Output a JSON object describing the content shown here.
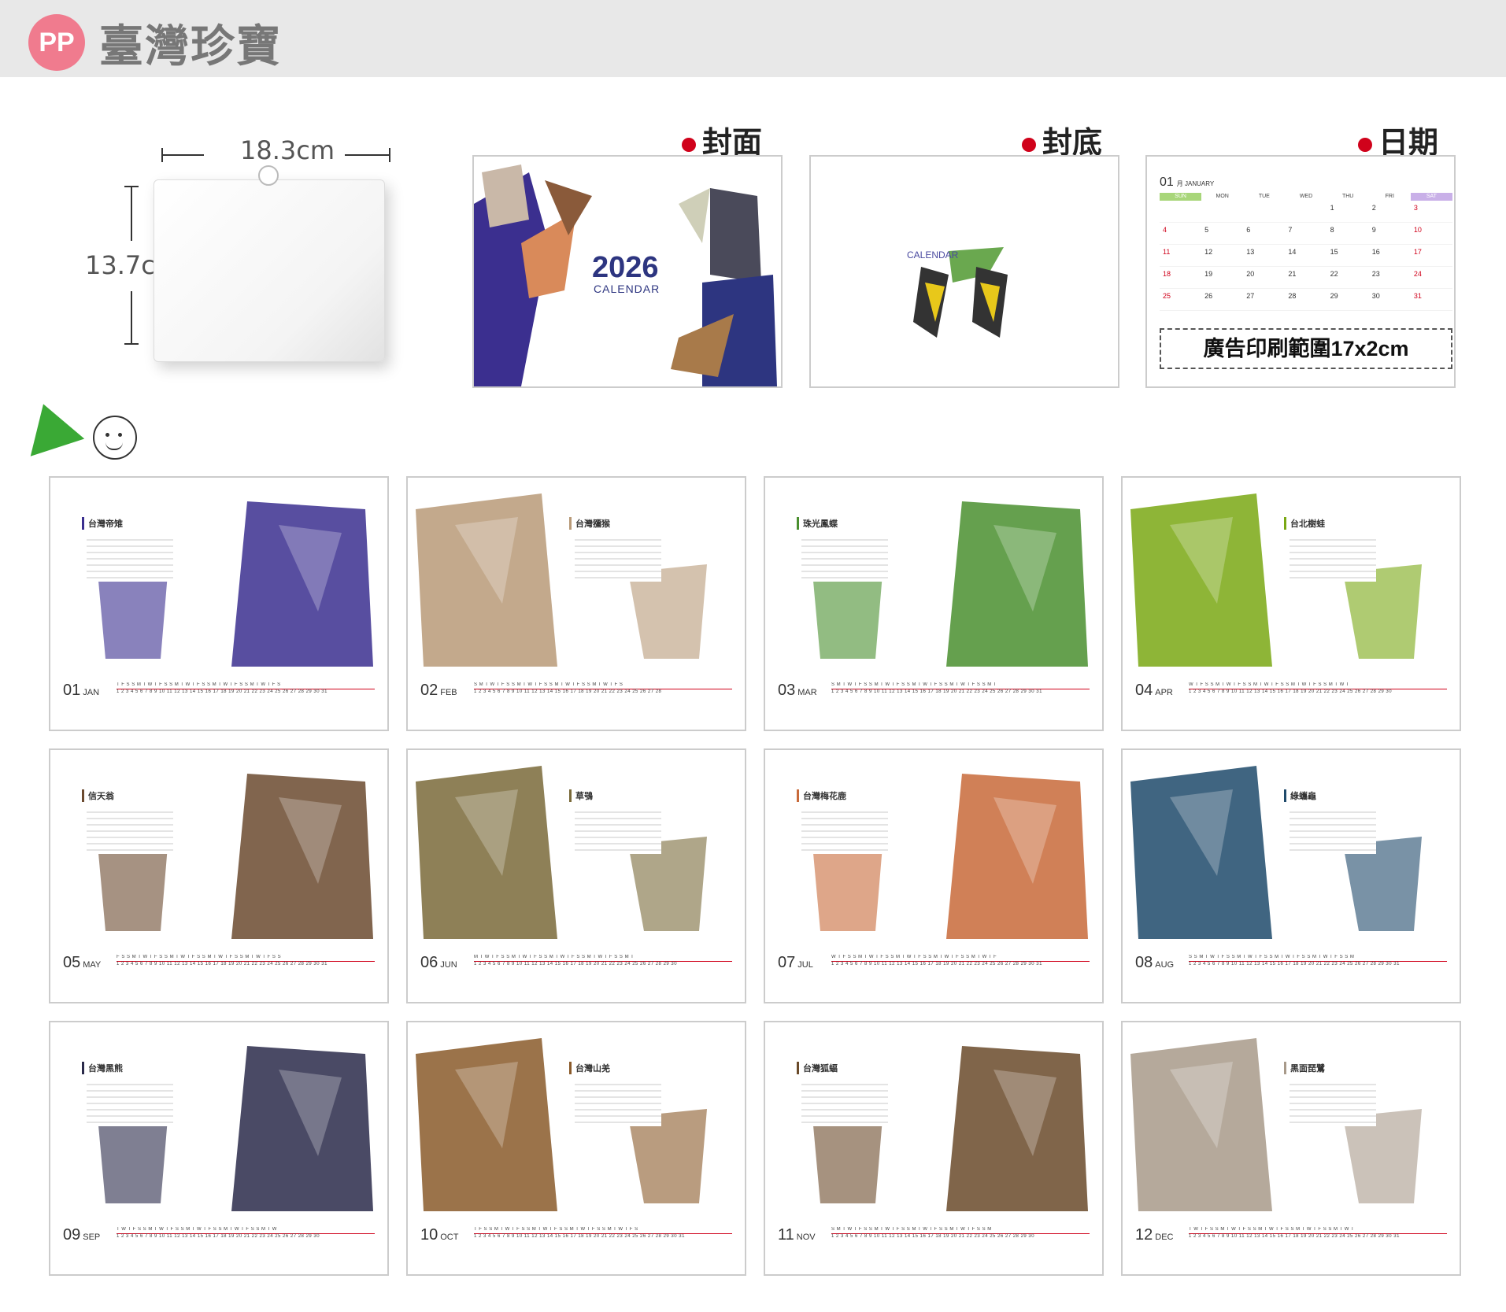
{
  "header": {
    "logo_text": "PP",
    "brand": "臺灣珍寶"
  },
  "dimensions": {
    "width": "18.3cm",
    "height": "13.7cm"
  },
  "sections": {
    "front": "封面",
    "back": "封底",
    "date": "日期"
  },
  "front_cover": {
    "year": "2026",
    "word": "CALENDAR"
  },
  "back_cover": {
    "word": "CALENDAR"
  },
  "date_page": {
    "month_num": "01",
    "month_name": "月 JANUARY",
    "weekdays": [
      "SUN",
      "MON",
      "TUE",
      "WED",
      "THU",
      "FRI",
      "SAT"
    ],
    "days": [
      "",
      "",
      "",
      "",
      "1",
      "2",
      "3",
      "4",
      "5",
      "6",
      "7",
      "8",
      "9",
      "10",
      "11",
      "12",
      "13",
      "14",
      "15",
      "16",
      "17",
      "18",
      "19",
      "20",
      "21",
      "22",
      "23",
      "24",
      "25",
      "26",
      "27",
      "28",
      "29",
      "30",
      "31"
    ],
    "ad_text": "廣告印刷範圍17x2cm"
  },
  "months": [
    {
      "num": "01",
      "name": "JAN",
      "title": "台灣帝雉",
      "strip": "T F S S M T W T F S S M T W T F S S M T W T F S S M T W T F S",
      "dates": "1 2 3 4 5 6 7 8 9 10 11 12 13 14 15 16 17 18 19 20 21 22 23 24 25 26 27 28 29 30 31",
      "accent": "#3b2f8f"
    },
    {
      "num": "02",
      "name": "FEB",
      "title": "台灣獼猴",
      "strip": "S M T W T F S S M T W T F S S M T W T F S S M T W T F S",
      "dates": "1 2 3 4 5 6 7 8 9 10 11 12 13 14 15 16 17 18 19 20 21 22 23 24 25 26 27 28",
      "accent": "#b89a78"
    },
    {
      "num": "03",
      "name": "MAR",
      "title": "珠光鳳蝶",
      "strip": "S M T W T F S S M T W T F S S M T W T F S S M T W T F S S M T",
      "dates": "1 2 3 4 5 6 7 8 9 10 11 12 13 14 15 16 17 18 19 20 21 22 23 24 25 26 27 28 29 30 31",
      "accent": "#4a8f2f"
    },
    {
      "num": "04",
      "name": "APR",
      "title": "台北樹蛙",
      "strip": "W T F S S M T W T F S S M T W T F S S M T W T F S S M T W T",
      "dates": "1 2 3 4 5 6 7 8 9 10 11 12 13 14 15 16 17 18 19 20 21 22 23 24 25 26 27 28 29 30",
      "accent": "#7aa814"
    },
    {
      "num": "05",
      "name": "MAY",
      "title": "信天翁",
      "strip": "F S S M T W T F S S M T W T F S S M T W T F S S M T W T F S S",
      "dates": "1 2 3 4 5 6 7 8 9 10 11 12 13 14 15 16 17 18 19 20 21 22 23 24 25 26 27 28 29 30 31",
      "accent": "#6b4a2f"
    },
    {
      "num": "06",
      "name": "JUN",
      "title": "草鴞",
      "strip": "M T W T F S S M T W T F S S M T W T F S S M T W T F S S M T",
      "dates": "1 2 3 4 5 6 7 8 9 10 11 12 13 14 15 16 17 18 19 20 21 22 23 24 25 26 27 28 29 30",
      "accent": "#7a6a3a"
    },
    {
      "num": "07",
      "name": "JUL",
      "title": "台灣梅花鹿",
      "strip": "W T F S S M T W T F S S M T W T F S S M T W T F S S M T W T F",
      "dates": "1 2 3 4 5 6 7 8 9 10 11 12 13 14 15 16 17 18 19 20 21 22 23 24 25 26 27 28 29 30 31",
      "accent": "#c86a3a"
    },
    {
      "num": "08",
      "name": "AUG",
      "title": "綠蠵龜",
      "strip": "S S M T W T F S S M T W T F S S M T W T F S S M T W T F S S M",
      "dates": "1 2 3 4 5 6 7 8 9 10 11 12 13 14 15 16 17 18 19 20 21 22 23 24 25 26 27 28 29 30 31",
      "accent": "#1f4a6b"
    },
    {
      "num": "09",
      "name": "SEP",
      "title": "台灣黑熊",
      "strip": "T W T F S S M T W T F S S M T W T F S S M T W T F S S M T W",
      "dates": "1 2 3 4 5 6 7 8 9 10 11 12 13 14 15 16 17 18 19 20 21 22 23 24 25 26 27 28 29 30",
      "accent": "#2a2a4a"
    },
    {
      "num": "10",
      "name": "OCT",
      "title": "台灣山羌",
      "strip": "T F S S M T W T F S S M T W T F S S M T W T F S S M T W T F S",
      "dates": "1 2 3 4 5 6 7 8 9 10 11 12 13 14 15 16 17 18 19 20 21 22 23 24 25 26 27 28 29 30 31",
      "accent": "#8a5a2a"
    },
    {
      "num": "11",
      "name": "NOV",
      "title": "台灣狐蝠",
      "strip": "S M T W T F S S M T W T F S S M T W T F S S M T W T F S S M",
      "dates": "1 2 3 4 5 6 7 8 9 10 11 12 13 14 15 16 17 18 19 20 21 22 23 24 25 26 27 28 29 30",
      "accent": "#6a4a2a"
    },
    {
      "num": "12",
      "name": "DEC",
      "title": "黑面琵鷺",
      "strip": "T W T F S S M T W T F S S M T W T F S S M T W T F S S M T W T",
      "dates": "1 2 3 4 5 6 7 8 9 10 11 12 13 14 15 16 17 18 19 20 21 22 23 24 25 26 27 28 29 30 31",
      "accent": "#a89a8a"
    }
  ]
}
